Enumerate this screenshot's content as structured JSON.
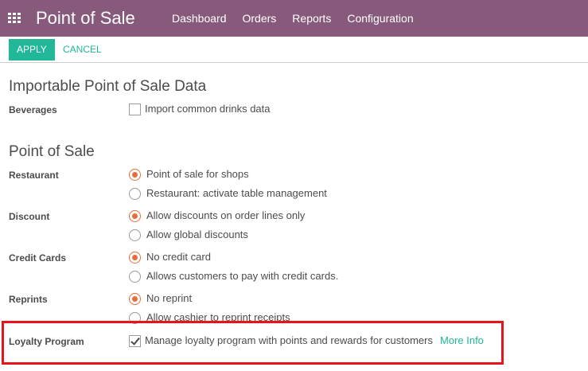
{
  "topbar": {
    "app_title": "Point of Sale",
    "menu": [
      "Dashboard",
      "Orders",
      "Reports",
      "Configuration"
    ],
    "apps_icon": "grid-icon"
  },
  "control_panel": {
    "apply_label": "APPLY",
    "cancel_label": "CANCEL"
  },
  "sections": {
    "importable": {
      "title": "Importable Point of Sale Data",
      "beverages": {
        "label": "Beverages",
        "option": "Import common drinks data",
        "checked": false
      }
    },
    "pos": {
      "title": "Point of Sale",
      "restaurant": {
        "label": "Restaurant",
        "options": [
          "Point of sale for shops",
          "Restaurant: activate table management"
        ],
        "selected": 0
      },
      "discount": {
        "label": "Discount",
        "options": [
          "Allow discounts on order lines only",
          "Allow global discounts"
        ],
        "selected": 0
      },
      "credit_cards": {
        "label": "Credit Cards",
        "options": [
          "No credit card",
          "Allows customers to pay with credit cards."
        ],
        "selected": 0
      },
      "reprints": {
        "label": "Reprints",
        "options": [
          "No reprint",
          "Allow cashier to reprint receipts"
        ],
        "selected": 0
      },
      "loyalty": {
        "label": "Loyalty Program",
        "option": "Manage loyalty program with points and rewards for customers",
        "checked": true,
        "link": "More Info"
      }
    }
  },
  "colors": {
    "topbar": "#875a7b",
    "accent": "#21b799",
    "radio_selected": "#e36f3e",
    "highlight_box": "#e8141c"
  }
}
